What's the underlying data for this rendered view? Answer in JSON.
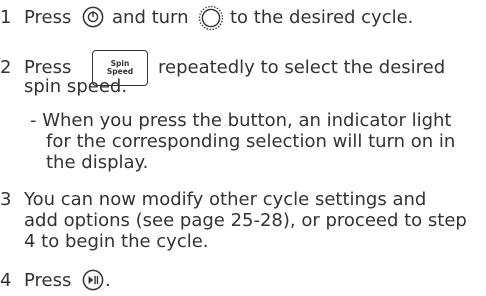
{
  "colors": {
    "text": "#333333",
    "background": "#ffffff"
  },
  "icons": {
    "power": "power-button-icon",
    "dial": "cycle-selector-knob-icon",
    "spin": "spin-speed-button-icon",
    "start": "start-pause-button-icon"
  },
  "steps": [
    {
      "number": "1",
      "before": "Press",
      "middle": "and turn",
      "after": "to the desired cycle."
    },
    {
      "number": "2",
      "before": "Press",
      "after": "repeatedly to select the desired",
      "line2": "spin speed.",
      "note_line1": "- When you press the button, an indicator light",
      "note_line2": "for the corresponding selection will turn on in",
      "note_line3": "the display."
    },
    {
      "number": "3",
      "line1": "You can now modify other cycle settings and",
      "line2": "add options (see page 25-28), or proceed to step",
      "line3": "4 to begin the cycle."
    },
    {
      "number": "4",
      "before": "Press",
      "after": "."
    }
  ],
  "spin_button": {
    "line1": "Spin",
    "line2": "Speed"
  }
}
